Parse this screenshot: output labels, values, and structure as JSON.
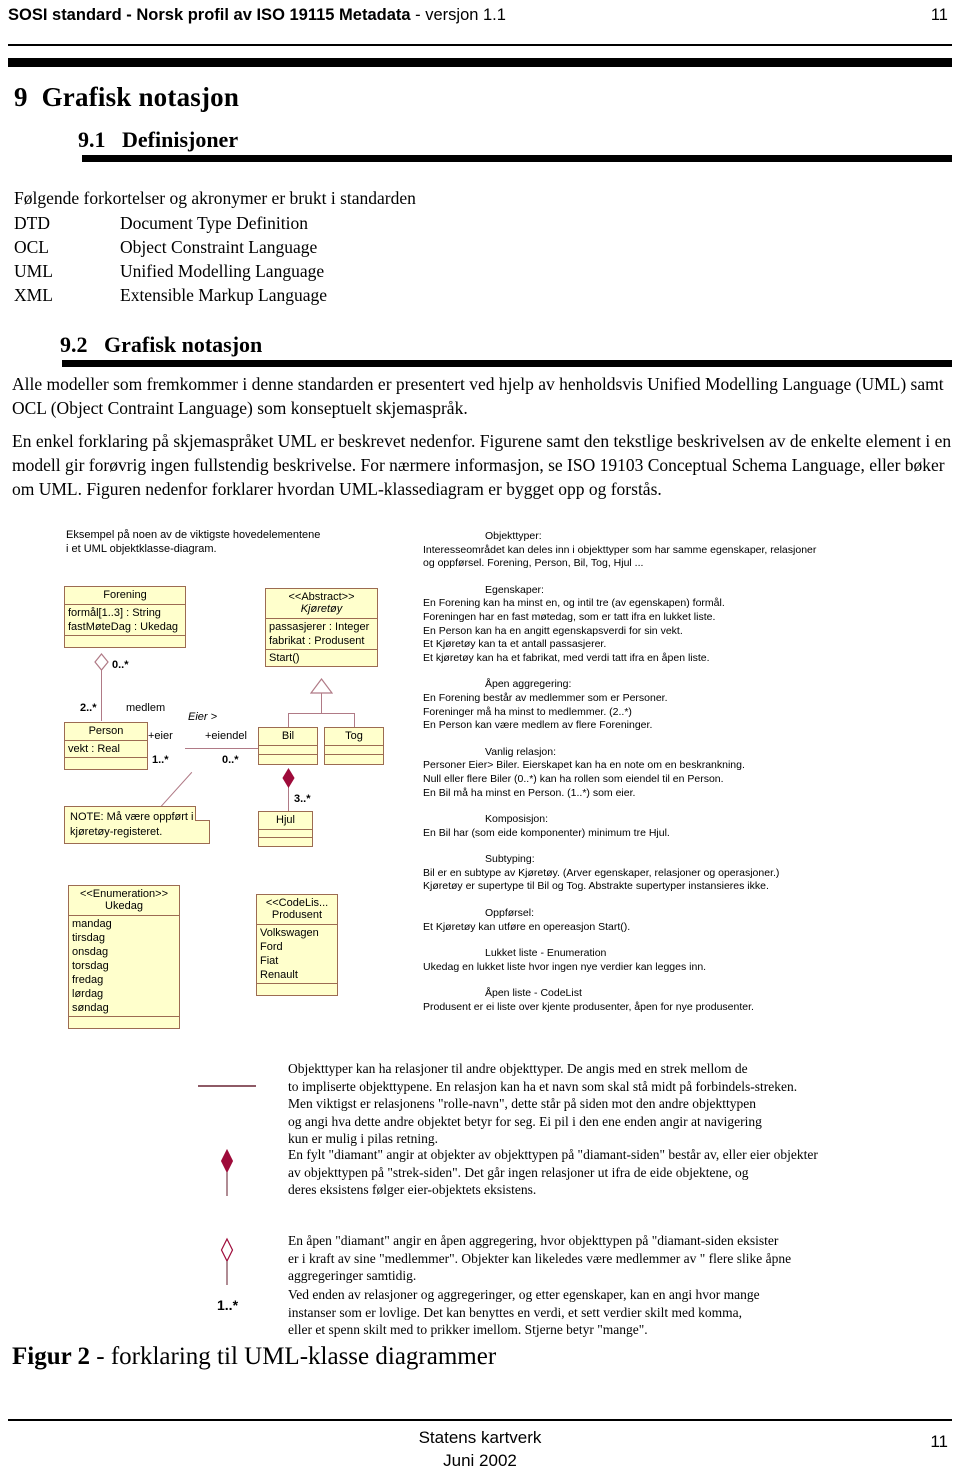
{
  "header": {
    "title_bold": "SOSI standard - Norsk profil av ISO 19115 Metadata",
    "title_regular": " - versjon 1.1",
    "page_number": "11"
  },
  "chapter": {
    "number": "9",
    "title": "Grafisk notasjon"
  },
  "section_91": {
    "number": "9.1",
    "title": "Definisjoner",
    "intro": "Følgende forkortelser og akronymer er brukt i standarden",
    "abbreviations": [
      {
        "key": "DTD",
        "value": "Document Type Definition"
      },
      {
        "key": "OCL",
        "value": "Object Constraint Language"
      },
      {
        "key": "UML",
        "value": "Unified Modelling Language"
      },
      {
        "key": "XML",
        "value": "Extensible Markup Language"
      }
    ]
  },
  "section_92": {
    "number": "9.2",
    "title": "Grafisk notasjon",
    "paragraph1": "Alle modeller som fremkommer i denne standarden er presentert ved hjelp av henholdsvis Unified Modelling Language (UML) samt OCL (Object Contraint Language) som konseptuelt skjemaspråk.",
    "paragraph2": "En enkel forklaring på skjemaspråket UML er beskrevet nedenfor. Figurene samt den tekstlige beskrivelsen av de enkelte element i en modell gir forøvrig ingen fullstendig beskrivelse. For nærmere informasjon, se ISO 19103 Conceptual Schema Language, eller bøker om UML. Figuren nedenfor forklarer hvordan UML-klassediagram er bygget opp og forstås."
  },
  "figure": {
    "caption_bold": "Figur 2",
    "caption_rest": " - forklaring til UML-klasse diagrammer",
    "diagram_note_line1": "Eksempel på noen av de viktigste hovedelementene",
    "diagram_note_line2": "i et UML objektklasse-diagram.",
    "classes": {
      "forening": {
        "name": "Forening",
        "attributes": [
          "formål[1..3] : String",
          "fastMøteDag : Ukedag"
        ]
      },
      "person": {
        "name": "Person",
        "attributes": [
          "vekt : Real"
        ]
      },
      "kjoretoy": {
        "stereotype": "<<Abstract>>",
        "name": "Kjøretøy",
        "attributes": [
          "passasjerer : Integer",
          "fabrikat : Produsent"
        ],
        "operations": [
          "Start()"
        ]
      },
      "bil": {
        "name": "Bil"
      },
      "tog": {
        "name": "Tog"
      },
      "hjul": {
        "name": "Hjul"
      },
      "ukedag": {
        "stereotype": "<<Enumeration>>",
        "name": "Ukedag",
        "values": [
          "mandag",
          "tirsdag",
          "onsdag",
          "torsdag",
          "fredag",
          "lørdag",
          "søndag"
        ]
      },
      "produsent": {
        "stereotype": "<<CodeLis...",
        "name": "Produsent",
        "values": [
          "Volkswagen",
          "Ford",
          "Fiat",
          "Renault"
        ]
      }
    },
    "note_box": {
      "line1": "NOTE: Må være oppført i",
      "line2": "kjøretøy-registeret."
    },
    "connector_labels": {
      "forening_mult": "0..*",
      "person_mult": "2..*",
      "medlem_role": "medlem",
      "eier_assoc": "Eier >",
      "eier_role": "+eier",
      "eiendel_role": "+eiendel",
      "person_eier_mult": "1..*",
      "bil_eiendel_mult": "0..*",
      "hjul_mult": "3..*"
    },
    "right_column": [
      {
        "heading": "Objekttyper:",
        "lines": [
          "Interesseområdet kan deles inn i objekttyper som har samme egenskaper, relasjoner",
          "og oppførsel.  Forening, Person, Bil, Tog, Hjul ..."
        ]
      },
      {
        "heading": "Egenskaper:",
        "lines": [
          "En Forening kan ha minst en, og intil tre (av egenskapen) formål.",
          "Foreningen har en fast møtedag, som er tatt ifra en lukket liste.",
          "En Person kan ha en angitt egenskapsverdi for sin vekt.",
          "Et Kjøretøy kan ta et antall passasjerer.",
          "Et kjøretøy kan ha et fabrikat, med verdi tatt ifra en åpen liste."
        ]
      },
      {
        "heading": "Åpen aggregering:",
        "lines": [
          "En Forening består av medlemmer som er Personer.",
          "Foreninger må ha minst to medlemmer. (2..*)",
          "En Person kan være medlem av flere Foreninger."
        ]
      },
      {
        "heading": "Vanlig relasjon:",
        "lines": [
          "Personer Eier> Biler. Eierskapet kan ha en note om en beskrankning.",
          "Null eller flere Biler (0..*)  kan ha rollen som eiendel til en Person.",
          "En Bil må ha minst en Person. (1..*) som eier."
        ]
      },
      {
        "heading": "Komposisjon:",
        "lines": [
          "En Bil har (som eide komponenter) minimum tre Hjul."
        ]
      },
      {
        "heading": "Subtyping:",
        "lines": [
          "Bil er en subtype av Kjøretøy. (Arver egenskaper, relasjoner og operasjoner.)",
          "Kjøretøy er supertype til Bil og Tog. Abstrakte supertyper instansieres ikke."
        ]
      },
      {
        "heading": "Oppførsel:",
        "lines": [
          "Et Kjøretøy kan utføre en opereasjon Start()."
        ]
      },
      {
        "heading": "Lukket liste - Enumeration",
        "lines": [
          "Ukedag en lukket liste hvor ingen nye verdier kan legges inn."
        ]
      },
      {
        "heading": "Åpen liste - CodeList",
        "lines": [
          "Produsent er ei liste over kjente produsenter, åpen for nye produsenter."
        ]
      }
    ],
    "legend": [
      {
        "symbol": "plain-line",
        "lines": [
          "Objekttyper kan ha relasjoner til andre objekttyper.  De angis med en strek mellom de",
          "to impliserte objekttypene. En relasjon kan ha et navn som skal stå midt på forbindels-streken.",
          "Men viktigst er relasjonens \"rolle-navn\", dette står på siden mot den andre objekttypen",
          "og angi hva dette andre objektet betyr for seg. Ei pil i den ene enden angir at navigering",
          "kun er mulig i pilas retning."
        ]
      },
      {
        "symbol": "filled-diamond",
        "lines": [
          "En fylt \"diamant\" angir at objekter av objekttypen på \"diamant-siden\" består av, eller eier objekter",
          "av objekttypen på \"strek-siden\". Det går ingen relasjoner ut ifra de eide objektene, og",
          "deres eksistens følger eier-objektets eksistens."
        ]
      },
      {
        "symbol": "open-diamond",
        "lines": [
          "En åpen \"diamant\" angir en åpen aggregering, hvor objekttypen på \"diamant-siden eksister",
          "er i kraft av sine \"medlemmer\". Objekter kan likeledes være medlemmer av \" flere slike åpne",
          "aggregeringer samtidig."
        ]
      },
      {
        "symbol": "multiplicity",
        "symbol_text": "1..*",
        "lines": [
          "Ved enden av relasjoner og aggregeringer, og etter egenskaper, kan en angi hvor mange",
          "instanser som er lovlige. Det kan benyttes en verdi, et sett verdier skilt med komma,",
          "eller et spenn skilt med to prikker imellom. Stjerne betyr \"mange\"."
        ]
      }
    ]
  },
  "footer": {
    "line1": "Statens kartverk",
    "line2": "Juni 2002",
    "page_number": "11"
  },
  "colors": {
    "class_fill": "#FFFFCC",
    "class_border": "#9C6B52",
    "connector": "#B07A86",
    "diamond_filled": "#9E0B3A"
  }
}
